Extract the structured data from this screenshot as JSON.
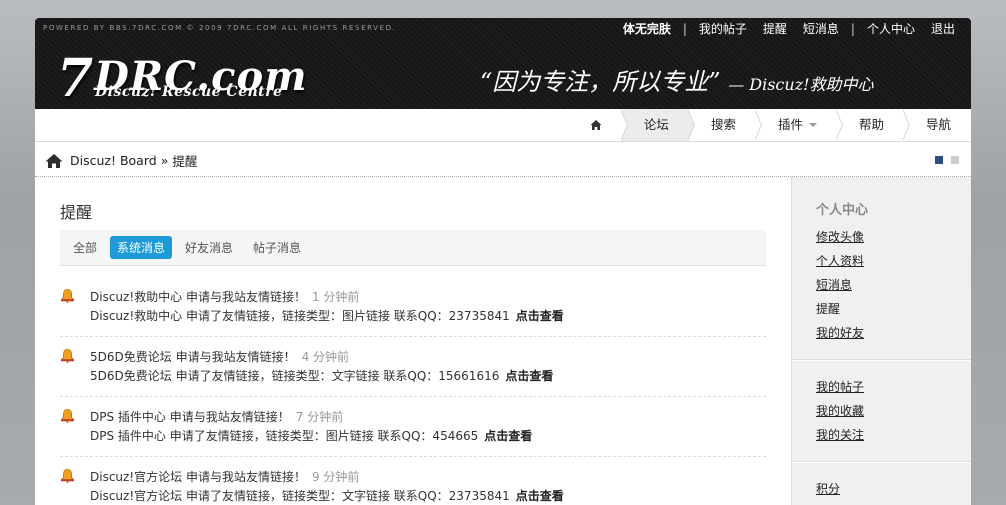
{
  "header": {
    "powered": "POWERED BY BBS.7DRC.COM © 2009 7DRC.COM ALL RIGHTS RESERVED.",
    "toplinks": [
      "体无完肤",
      "我的帖子",
      "提醒",
      "短消息",
      "个人中心",
      "退出"
    ],
    "logo_main": "DRC.com",
    "logo_seven": "7",
    "logo_sub": "Discuz! Rescue Centre",
    "slogan": "“因为专注，所以专业”",
    "slogan_tail": "— Discuz!救助中心"
  },
  "nav": {
    "items": [
      "论坛",
      "搜索",
      "插件",
      "帮助",
      "导航"
    ],
    "active": "论坛"
  },
  "breadcrumb": {
    "root": "Discuz! Board",
    "sep": "»",
    "current": "提醒"
  },
  "main": {
    "title": "提醒",
    "tabs": [
      "全部",
      "系统消息",
      "好友消息",
      "帖子消息"
    ],
    "active_tab": "系统消息",
    "notices": [
      {
        "from": "Discuz!救助中心",
        "action": "申请与我站友情链接！",
        "time": "1 分钟前",
        "detail": "Discuz!救助中心 申请了友情链接，链接类型：图片链接 联系QQ：23735841",
        "link": "点击查看"
      },
      {
        "from": "5D6D免费论坛",
        "action": "申请与我站友情链接！",
        "time": "4 分钟前",
        "detail": "5D6D免费论坛 申请了友情链接，链接类型：文字链接 联系QQ：15661616",
        "link": "点击查看"
      },
      {
        "from": "DPS 插件中心",
        "action": "申请与我站友情链接！",
        "time": "7 分钟前",
        "detail": "DPS 插件中心 申请了友情链接，链接类型：图片链接 联系QQ：454665",
        "link": "点击查看"
      },
      {
        "from": "Discuz!官方论坛",
        "action": "申请与我站友情链接！",
        "time": "9 分钟前",
        "detail": "Discuz!官方论坛 申请了友情链接，链接类型：文字链接 联系QQ：23735841",
        "link": "点击查看"
      }
    ]
  },
  "sidebar": {
    "title": "个人中心",
    "group1": [
      "修改头像",
      "个人资料",
      "短消息",
      "提醒",
      "我的好友"
    ],
    "group2": [
      "我的帖子",
      "我的收藏",
      "我的关注"
    ],
    "group3": [
      "积分"
    ]
  },
  "colors": {
    "accent": "#1e9bd7",
    "dark_header": "#1b1b1b",
    "slide_dot": "#2a4f8a"
  }
}
